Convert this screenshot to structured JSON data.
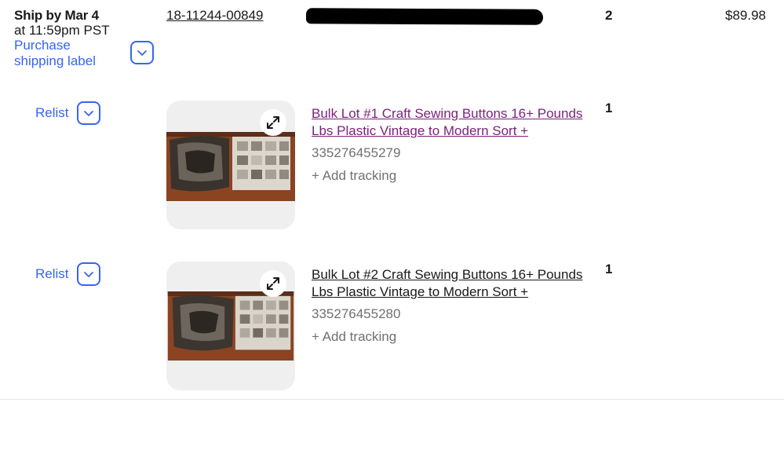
{
  "order": {
    "ship_by": "Ship by Mar 4",
    "ship_time": "at 11:59pm PST",
    "purchase_label": "Purchase shipping label",
    "order_number": "18-11244-00849",
    "quantity": "2",
    "total": "$89.98"
  },
  "items": [
    {
      "relist": "Relist",
      "title": "Bulk Lot #1 Craft Sewing Buttons 16+ Pounds Lbs Plastic Vintage to Modern Sort +",
      "item_number": "335276455279",
      "add_tracking": "+ Add tracking",
      "quantity": "1",
      "title_color": "#7b1f7c"
    },
    {
      "relist": "Relist",
      "title": "Bulk Lot #2 Craft Sewing Buttons 16+ Pounds Lbs Plastic Vintage to Modern Sort +",
      "item_number": "335276455280",
      "add_tracking": "+ Add tracking",
      "quantity": "1",
      "title_color": "#191919"
    }
  ],
  "icons": {
    "dropdown": "chevron-down-icon",
    "expand": "expand-arrows-icon"
  },
  "colors": {
    "link_blue": "#3665f3",
    "visited_purple": "#7b1f7c",
    "secondary_text": "#707070"
  }
}
